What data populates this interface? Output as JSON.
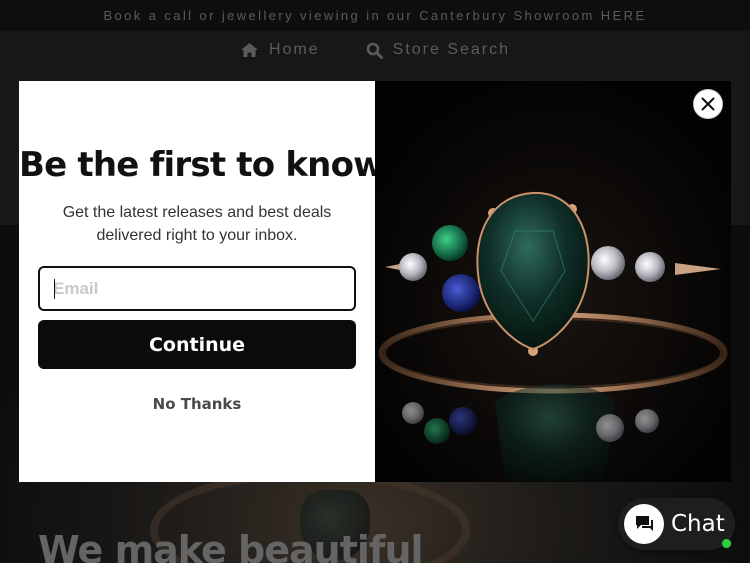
{
  "announcement": {
    "text": "Book a call or jewellery viewing in our Canterbury Showroom HERE"
  },
  "nav": {
    "items": [
      {
        "label": "Home",
        "icon": "home-icon"
      },
      {
        "label": "Store Search",
        "icon": "search-icon"
      }
    ]
  },
  "hero": {
    "title": "We make beautiful"
  },
  "popup": {
    "headline": "Be the first to know",
    "subtitle": "Get the latest releases and best deals delivered right to your inbox.",
    "email": {
      "placeholder": "Email",
      "value": ""
    },
    "continue_label": "Continue",
    "no_thanks_label": "No Thanks",
    "close_icon": "close-icon",
    "image": "emerald-ring-photo"
  },
  "chat": {
    "label": "Chat",
    "icon": "chat-bubble-icon",
    "status_color": "#2ecc40"
  },
  "colors": {
    "button_bg": "#0b0b0b",
    "popup_bg": "#ffffff",
    "page_bg": "#1b1b1b"
  }
}
